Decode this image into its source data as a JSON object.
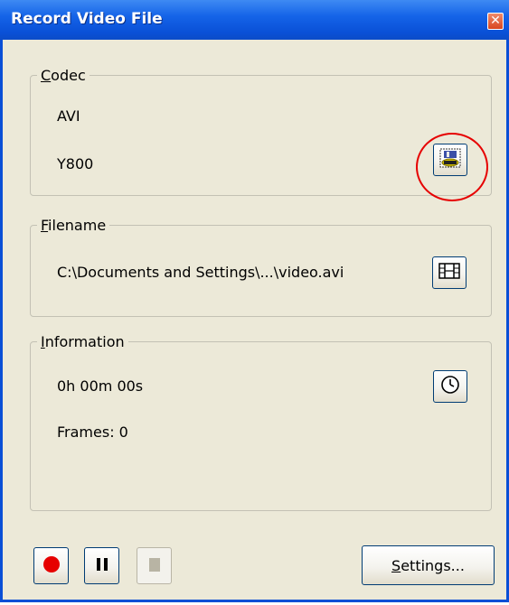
{
  "window": {
    "title": "Record Video File",
    "close_glyph": "✕"
  },
  "codec": {
    "legend": "Codec",
    "legend_access": "C",
    "legend_rest": "odec",
    "format": "AVI",
    "fourcc": "Y800",
    "config_icon": "codec-properties-icon"
  },
  "filename": {
    "legend_access": "F",
    "legend_rest": "ilename",
    "path": "C:\\Documents and Settings\\...\\video.avi",
    "browse_icon": "film-browse-icon"
  },
  "information": {
    "legend_access": "I",
    "legend_rest": "nformation",
    "elapsed": "0h 00m 00s",
    "frames": "Frames: 0",
    "timer_icon": "clock-icon"
  },
  "controls": {
    "record_icon": "record-icon",
    "pause_icon": "pause-icon",
    "stop_icon": "stop-icon",
    "stop_enabled": false,
    "settings_access": "S",
    "settings_rest": "ettings..."
  },
  "colors": {
    "title_bar": "#0a51d8",
    "dialog_bg": "#ece9d8",
    "record_red": "#e60000",
    "highlight_circle": "#e60000"
  }
}
